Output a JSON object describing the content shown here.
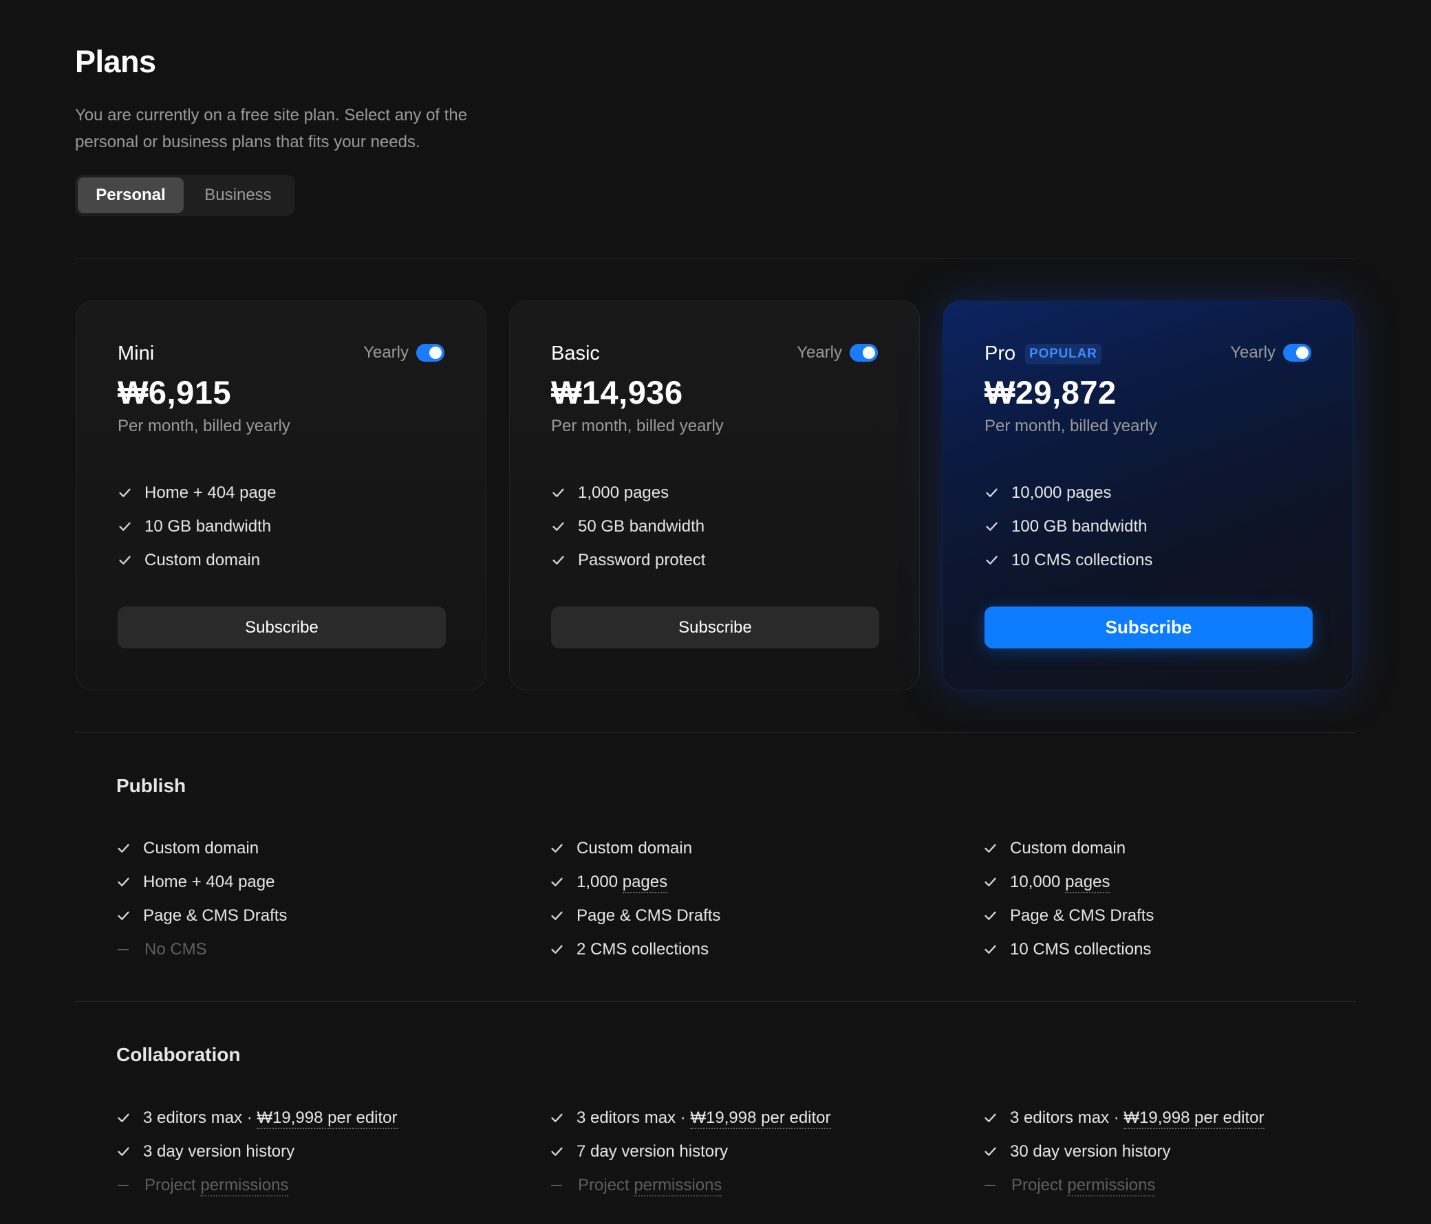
{
  "header": {
    "title": "Plans",
    "description": "You are currently on a free site plan. Select any of the personal or business plans that fits your needs."
  },
  "plan_type_toggle": {
    "options": [
      "Personal",
      "Business"
    ],
    "selected": "Personal"
  },
  "colors": {
    "background": "#121212",
    "accent": "#0d7cff",
    "toggle_on": "#1a7cff",
    "badge_text": "#3d8bff"
  },
  "plans": [
    {
      "name": "Mini",
      "billing_toggle_label": "Yearly",
      "yearly_enabled": true,
      "price": "₩6,915",
      "billing_note": "Per month, billed yearly",
      "features": [
        "Home + 404 page",
        "10 GB bandwidth",
        "Custom domain"
      ],
      "button_label": "Subscribe"
    },
    {
      "name": "Basic",
      "billing_toggle_label": "Yearly",
      "yearly_enabled": true,
      "price": "₩14,936",
      "billing_note": "Per month, billed yearly",
      "features": [
        "1,000 pages",
        "50 GB bandwidth",
        "Password protect"
      ],
      "button_label": "Subscribe"
    },
    {
      "name": "Pro",
      "badge": "POPULAR",
      "billing_toggle_label": "Yearly",
      "yearly_enabled": true,
      "price": "₩29,872",
      "billing_note": "Per month, billed yearly",
      "features": [
        "10,000 pages",
        "100 GB bandwidth",
        "10 CMS collections"
      ],
      "button_label": "Subscribe"
    }
  ],
  "sections": [
    {
      "title": "Publish",
      "columns": [
        [
          {
            "text": "Custom domain",
            "included": true
          },
          {
            "text": "Home + 404 page",
            "included": true
          },
          {
            "text": "Page & CMS Drafts",
            "included": true
          },
          {
            "text": "No CMS",
            "included": false
          }
        ],
        [
          {
            "text": "Custom domain",
            "included": true
          },
          {
            "pre": "1,000 ",
            "link": "pages",
            "included": true
          },
          {
            "text": "Page & CMS Drafts",
            "included": true
          },
          {
            "text": "2 CMS collections",
            "included": true
          }
        ],
        [
          {
            "text": "Custom domain",
            "included": true
          },
          {
            "pre": "10,000 ",
            "link": "pages",
            "included": true
          },
          {
            "text": "Page & CMS Drafts",
            "included": true
          },
          {
            "text": "10 CMS collections",
            "included": true
          }
        ]
      ]
    },
    {
      "title": "Collaboration",
      "columns": [
        [
          {
            "pre": "3 editors max · ",
            "link": "₩19,998 per editor",
            "included": true
          },
          {
            "text": "3 day version history",
            "included": true
          },
          {
            "pre": "Project ",
            "link": "permissions",
            "included": false
          }
        ],
        [
          {
            "pre": "3 editors max · ",
            "link": "₩19,998 per editor",
            "included": true
          },
          {
            "text": "7 day version history",
            "included": true
          },
          {
            "pre": "Project ",
            "link": "permissions",
            "included": false
          }
        ],
        [
          {
            "pre": "3 editors max · ",
            "link": "₩19,998 per editor",
            "included": true
          },
          {
            "text": "30 day version history",
            "included": true
          },
          {
            "pre": "Project ",
            "link": "permissions",
            "included": false
          }
        ]
      ]
    }
  ]
}
